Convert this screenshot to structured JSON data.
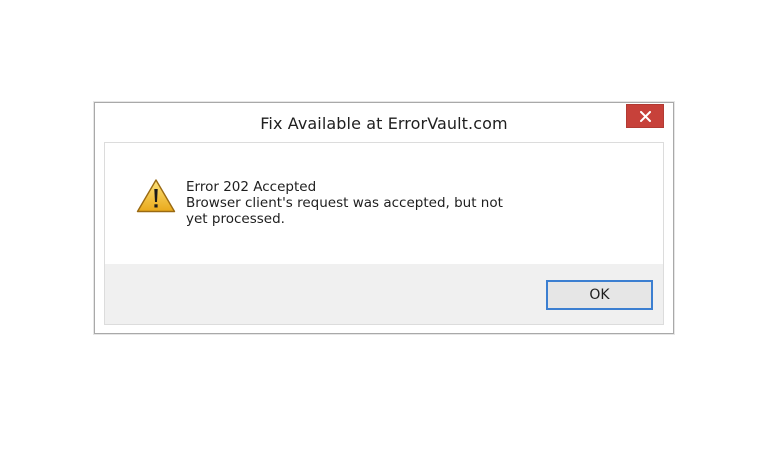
{
  "dialog": {
    "title": "Fix Available at ErrorVault.com",
    "close_icon": "close-icon",
    "icon": "warning-icon",
    "message_heading": "Error 202 Accepted",
    "message_body": "Browser client's request was accepted, but not yet processed.",
    "ok_label": "OK"
  },
  "colors": {
    "close_button": "#c7413a",
    "ok_border": "#3c7fd1",
    "footer_bg": "#f0f0f0",
    "warning_fill": "#f2c230"
  }
}
